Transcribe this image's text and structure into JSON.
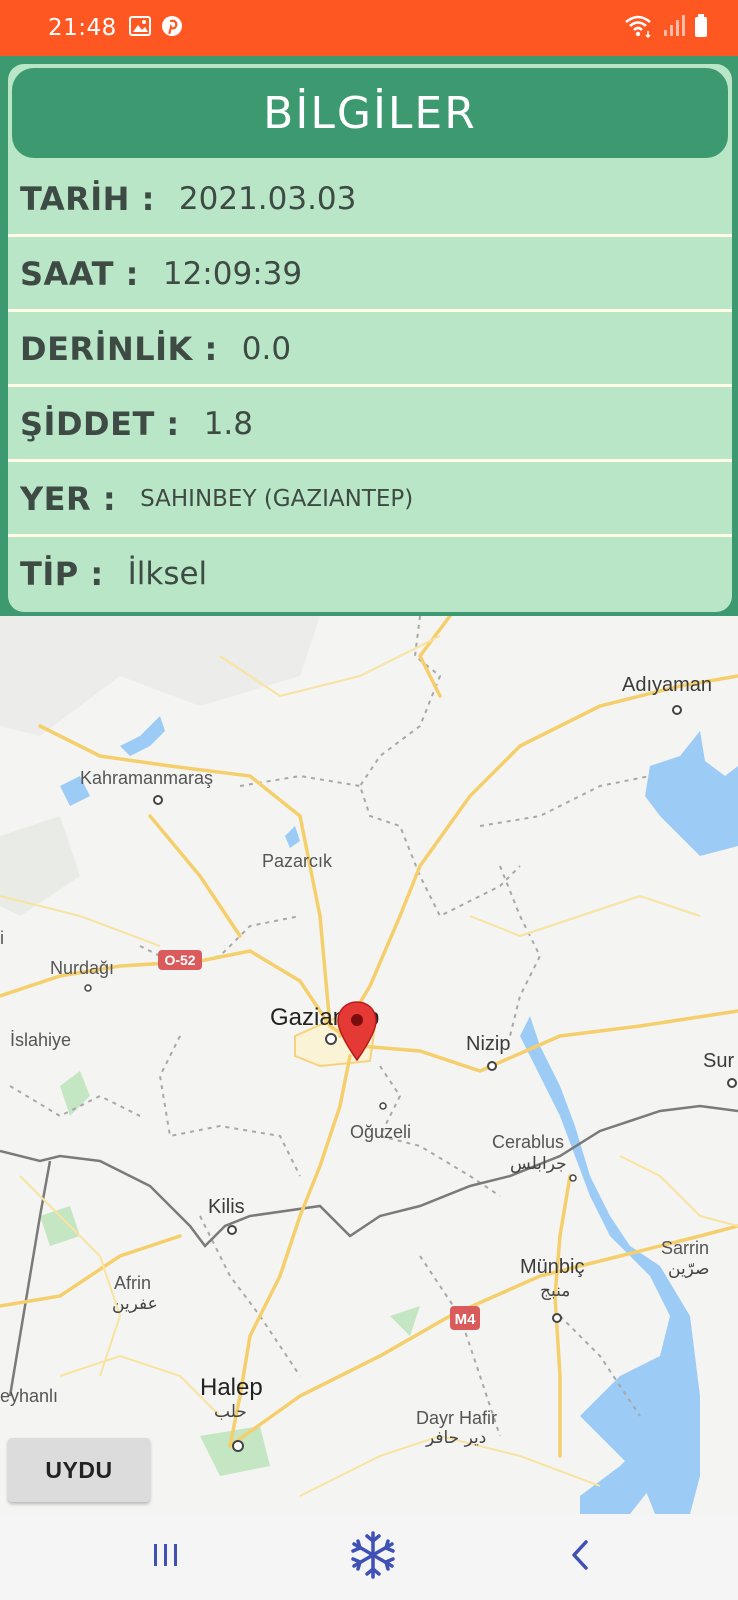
{
  "status_bar": {
    "time": "21:48",
    "icons": [
      "image-icon",
      "pinterest-icon",
      "wifi-icon",
      "signal-icon",
      "battery-icon"
    ]
  },
  "info": {
    "title": "BİLGİLER",
    "rows": [
      {
        "label": "TARİH :",
        "value": "2021.03.03"
      },
      {
        "label": "SAAT :",
        "value": "12:09:39"
      },
      {
        "label": "DERİNLİK :",
        "value": "0.0"
      },
      {
        "label": "ŞİDDET :",
        "value": "1.8"
      },
      {
        "label": "YER :",
        "value": "SAHINBEY (GAZIANTEP)"
      },
      {
        "label": "TİP :",
        "value": "İlksel"
      }
    ]
  },
  "map": {
    "cities": {
      "adiyaman": "Adıyaman",
      "kahramanmaras": "Kahramanmaraş",
      "pazarcik": "Pazarcık",
      "nurdagi": "Nurdağı",
      "gaziantep": "Gaziantep",
      "islahiye": "İslahiye",
      "nizip": "Nizip",
      "oguzeli": "Oğuzeli",
      "cerablus": "Cerablus",
      "cerablus_ar": "جرابلس",
      "kilis": "Kilis",
      "munbic": "Münbiç",
      "munbic_ar": "منبج",
      "sarrin": "Sarrin",
      "sarrin_ar": "صرّين",
      "afrin": "Afrin",
      "afrin_ar": "عفرين",
      "halep": "Halep",
      "halep_ar": "حلب",
      "dayr_hafir": "Dayr Hafir",
      "dayr_hafir_ar": "دير حافر",
      "reyhanli_partial": "eyhanlı",
      "sur_partial": "Sur",
      "edge_i": "i"
    },
    "road_shields": {
      "o52": "O-52",
      "m4": "M4"
    },
    "satellite_button": "UYDU"
  },
  "nav_bar": {
    "icons": [
      "recent-apps-icon",
      "snowflake-icon",
      "back-icon"
    ]
  }
}
